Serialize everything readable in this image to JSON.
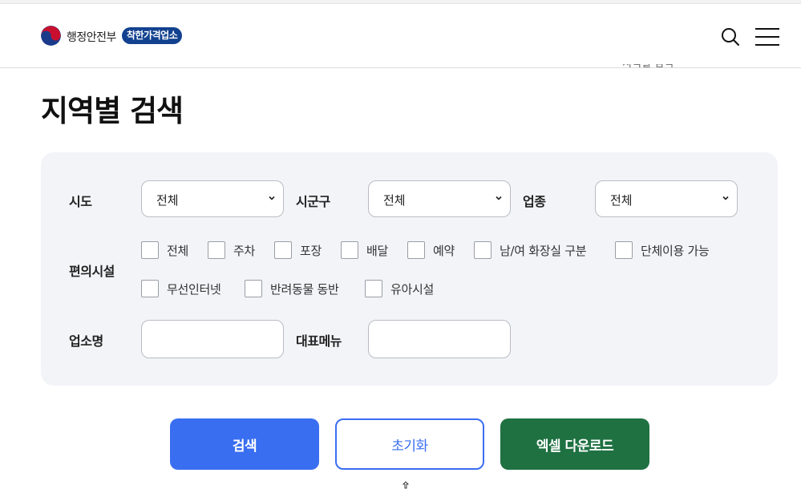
{
  "header": {
    "ministry": "행정안전부",
    "brand": "착한가격업소",
    "breadcrumb_ghost": "지역별 검색"
  },
  "icons": {
    "logo": "taegeuk-logo-icon",
    "search": "search-icon",
    "menu": "hamburger-menu-icon"
  },
  "page": {
    "title": "지역별 검색"
  },
  "filters": {
    "sido": {
      "label": "시도",
      "value": "전체"
    },
    "sigungu": {
      "label": "시군구",
      "value": "전체"
    },
    "category": {
      "label": "업종",
      "value": "전체"
    },
    "amenities": {
      "label": "편의시설",
      "options": [
        "전체",
        "주차",
        "포장",
        "배달",
        "예약",
        "남/여 화장실 구분",
        "단체이용 가능",
        "무선인터넷",
        "반려동물 동반",
        "유아시설"
      ]
    },
    "store_name": {
      "label": "업소명",
      "value": ""
    },
    "main_menu": {
      "label": "대표메뉴",
      "value": ""
    }
  },
  "buttons": {
    "search": "검색",
    "reset": "초기화",
    "excel": "엑셀 다운로드"
  },
  "colors": {
    "primary": "#3a6ef0",
    "excel": "#1f7142",
    "brand": "#12418f",
    "panel": "#f3f4f8"
  }
}
